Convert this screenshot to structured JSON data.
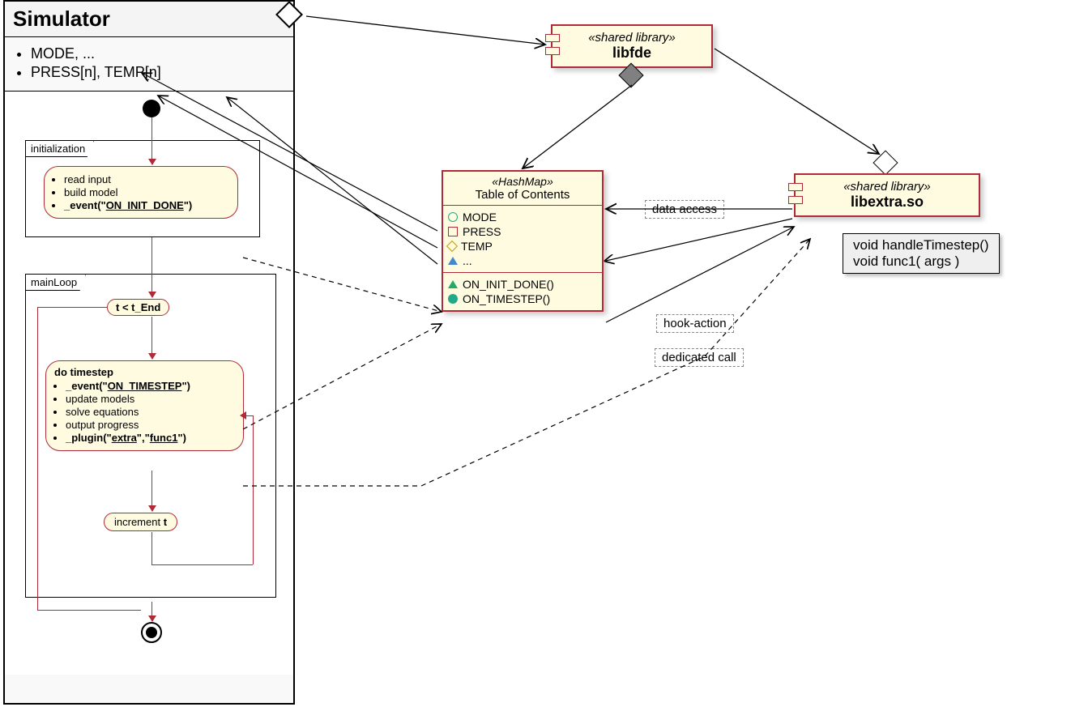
{
  "simulator": {
    "title": "Simulator",
    "attrs": [
      "MODE, ...",
      "PRESS[n], TEMP[n]"
    ],
    "init_frame_label": "initialization",
    "init_activity": {
      "items": [
        "read input",
        "build model"
      ],
      "event_label": "_event(\"",
      "event_name": "ON_INIT_DONE",
      "event_close": "\")"
    },
    "loop_frame_label": "mainLoop",
    "guard": "t < t_End",
    "timestep": {
      "heading": "do timestep",
      "event_label": "_event(\"",
      "event_name": "ON_TIMESTEP",
      "event_close": "\")",
      "items": [
        "update models",
        "solve equations",
        "output progress"
      ],
      "plugin_label": "_plugin(\"",
      "plugin_a": "extra",
      "plugin_mid": "\",\"",
      "plugin_b": "func1",
      "plugin_close": "\")"
    },
    "increment_prefix": "increment ",
    "increment_var": "t"
  },
  "libfde": {
    "stereotype": "«shared library»",
    "name": "libfde"
  },
  "toc": {
    "stereotype": "«HashMap»",
    "name": "Table of Contents",
    "data_items": [
      "MODE",
      "PRESS",
      "TEMP",
      "..."
    ],
    "hooks": [
      "ON_INIT_DONE()",
      "ON_TIMESTEP()"
    ]
  },
  "libextra": {
    "stereotype": "«shared library»",
    "name": "libextra.so",
    "methods": [
      "void handleTimestep()",
      "void func1( args )"
    ]
  },
  "labels": {
    "data_access": "data access",
    "hook_action": "hook-action",
    "dedicated_call": "dedicated call"
  }
}
